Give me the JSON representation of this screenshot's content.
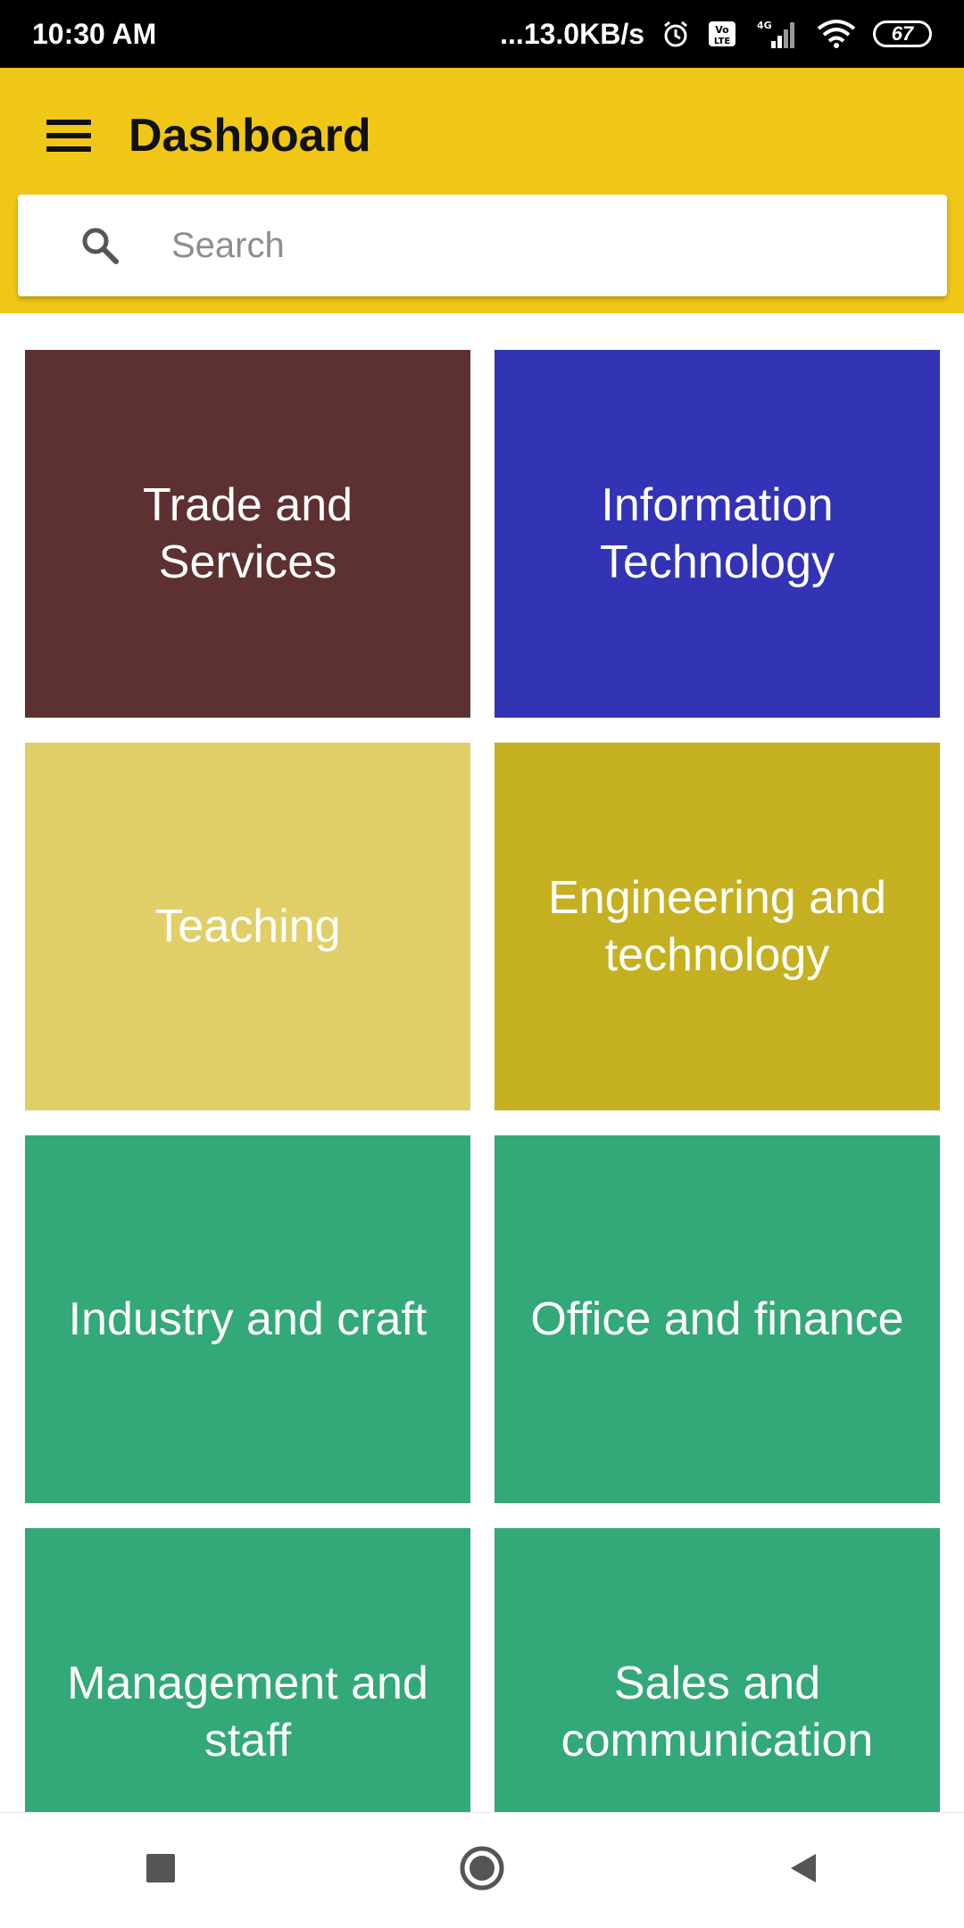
{
  "status_bar": {
    "time": "10:30 AM",
    "network_speed": "...13.0KB/s",
    "battery": "67",
    "icons": [
      "alarm-icon",
      "volte-icon",
      "signal-4g-icon",
      "wifi-icon",
      "battery-icon"
    ]
  },
  "app_bar": {
    "title": "Dashboard",
    "background": "#f0c717"
  },
  "search": {
    "placeholder": "Search",
    "value": ""
  },
  "categories": [
    {
      "label": "Trade and Services",
      "color": "#5d3131"
    },
    {
      "label": "Information Technology",
      "color": "#3333b5"
    },
    {
      "label": "Teaching",
      "color": "#e0cf69"
    },
    {
      "label": "Engineering and technology",
      "color": "#c5b021"
    },
    {
      "label": "Industry and craft",
      "color": "#33a878"
    },
    {
      "label": "Office and finance",
      "color": "#33a878"
    },
    {
      "label": "Management and staff",
      "color": "#33a878"
    },
    {
      "label": "Sales and communication",
      "color": "#33a878"
    }
  ],
  "nav_bar": {
    "buttons": [
      "recents-icon",
      "home-icon",
      "back-icon"
    ]
  }
}
